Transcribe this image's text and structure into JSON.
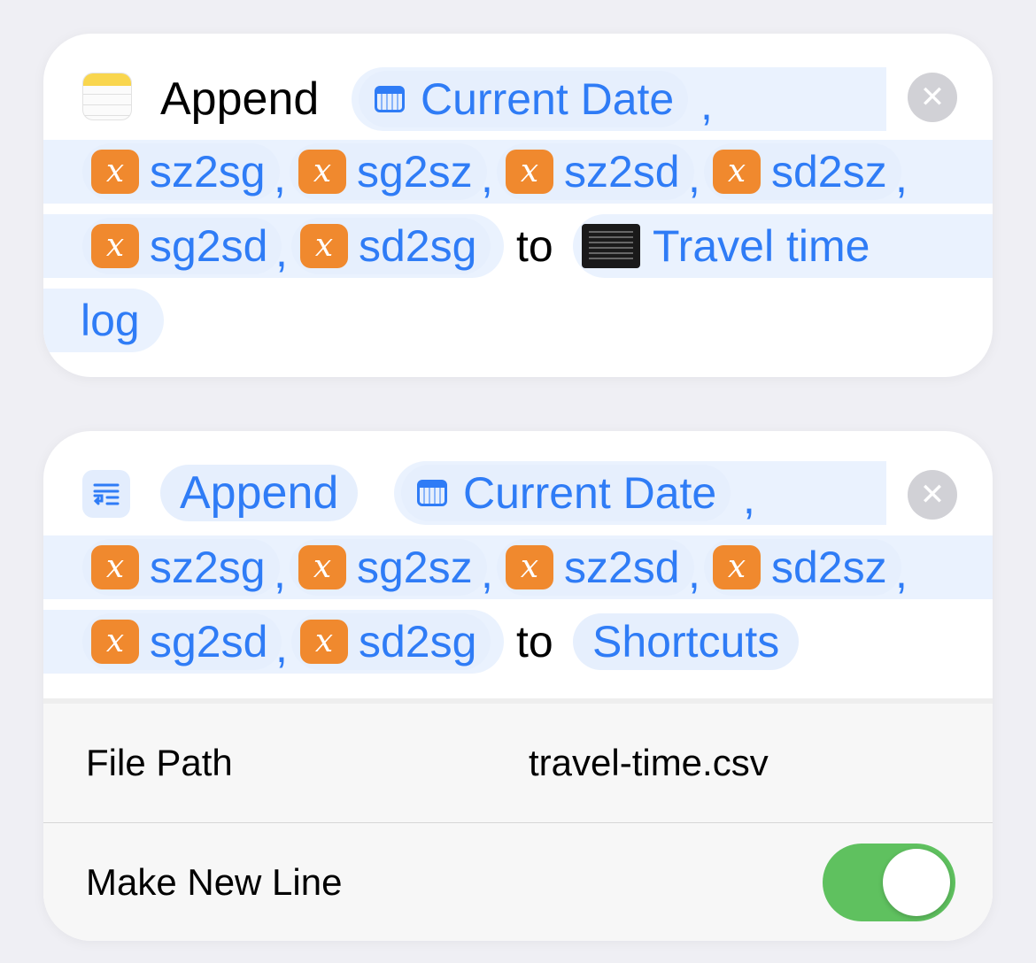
{
  "action1": {
    "verb": "Append",
    "date_token": "Current Date",
    "vars_row1": [
      "sz2sg",
      "sg2sz",
      "sz2sd",
      "sd2sz"
    ],
    "vars_row2": [
      "sg2sd",
      "sd2sg"
    ],
    "to": "to",
    "note_title": "Travel time",
    "note_title_cont": "log",
    "comma": ",",
    "icon": "notes-icon",
    "close_icon": "xmark-circle-icon"
  },
  "action2": {
    "verb": "Append",
    "date_token": "Current Date",
    "vars_row1": [
      "sz2sg",
      "sg2sz",
      "sz2sd",
      "sd2sz"
    ],
    "vars_row2": [
      "sg2sd",
      "sd2sg"
    ],
    "to": "to",
    "destination": "Shortcuts",
    "comma": ",",
    "icon": "append-text-icon",
    "close_icon": "xmark-circle-icon",
    "file_path_label": "File Path",
    "file_path_value": "travel-time.csv",
    "new_line_label": "Make New Line",
    "new_line_on": true,
    "toggle_color": "#5fc15f"
  },
  "variable_icon_glyph": "x",
  "accent": "#2f7cf6",
  "variable_color": "#f0892e"
}
